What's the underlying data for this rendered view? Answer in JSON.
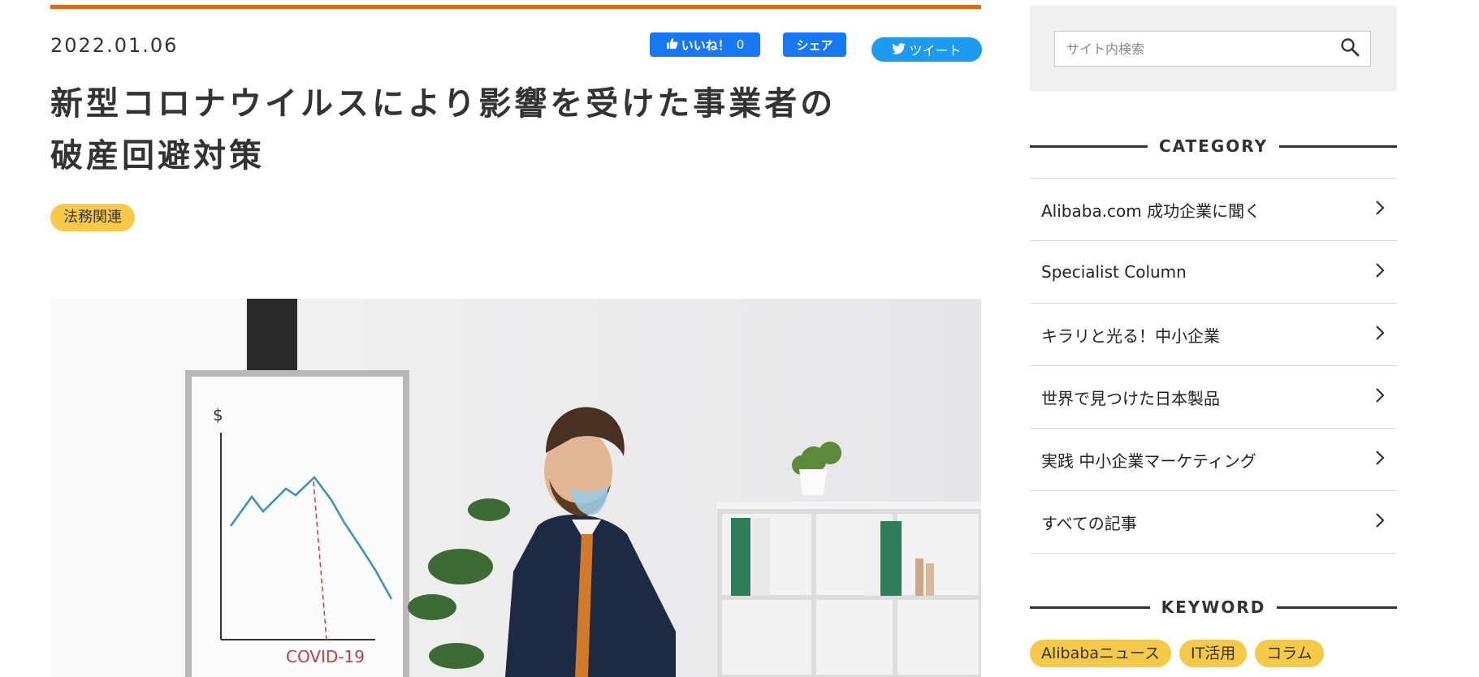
{
  "article": {
    "date": "2022.01.06",
    "title_line1": "新型コロナウイルスにより影響を受けた事業者の",
    "title_line2": "破産回避対策",
    "tag": "法務関連",
    "hero_chart_label": "COVID-19"
  },
  "share": {
    "like_label": "いいね！",
    "like_count": "0",
    "share_label": "シェア",
    "tweet_label": "ツイート"
  },
  "sidebar": {
    "search_placeholder": "サイト内検索",
    "category_heading": "CATEGORY",
    "categories": [
      {
        "label": "Alibaba.com 成功企業に聞く"
      },
      {
        "label": "Specialist Column"
      },
      {
        "label": "キラリと光る！中小企業"
      },
      {
        "label": "世界で見つけた日本製品"
      },
      {
        "label": "実践 中小企業マーケティング"
      },
      {
        "label": "すべての記事"
      }
    ],
    "keyword_heading": "KEYWORD",
    "keywords": [
      "Alibabaニュース",
      "IT活用",
      "コラム"
    ]
  },
  "colors": {
    "accent": "#e06a14",
    "tag": "#f7c948",
    "facebook": "#1877f2",
    "twitter": "#1d9bf0"
  },
  "icons": [
    "thumbs-up-icon",
    "twitter-bird-icon",
    "search-icon",
    "chevron-right-icon"
  ]
}
